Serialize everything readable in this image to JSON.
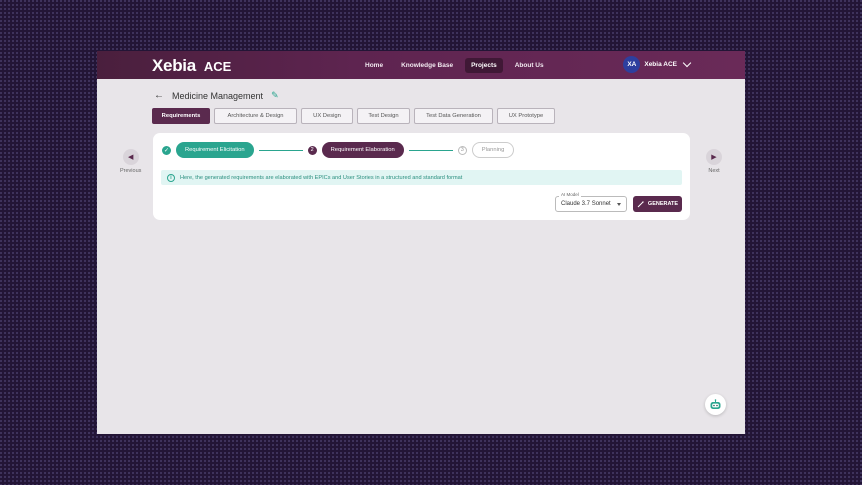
{
  "brand": {
    "logo_text": "Xebia",
    "product": "ACE"
  },
  "nav": [
    {
      "label": "Home",
      "active": false
    },
    {
      "label": "Knowledge Base",
      "active": false
    },
    {
      "label": "Projects",
      "active": true
    },
    {
      "label": "About Us",
      "active": false
    }
  ],
  "user": {
    "initials": "XA",
    "name": "Xebia ACE"
  },
  "page": {
    "back_icon": "arrow-left-icon",
    "title": "Medicine Management",
    "edit_icon": "pencil-icon"
  },
  "tabs": [
    {
      "label": "Requirements",
      "active": true
    },
    {
      "label": "Architecture & Design",
      "active": false
    },
    {
      "label": "UX Design",
      "active": false
    },
    {
      "label": "Test Design",
      "active": false
    },
    {
      "label": "Test Data Generation",
      "active": false
    },
    {
      "label": "UX Prototype",
      "active": false
    }
  ],
  "side_nav": {
    "previous": "Previous",
    "next": "Next"
  },
  "stepper": [
    {
      "marker": "✓",
      "label": "Requirement Elicitation",
      "state": "done"
    },
    {
      "marker": "2",
      "label": "Requirement Elaboration",
      "state": "current"
    },
    {
      "marker": "3",
      "label": "Planning",
      "state": "pending"
    }
  ],
  "info": {
    "icon": "info-icon",
    "text": "Here, the generated requirements are elaborated with EPICs and User Stories in a structured and standard format"
  },
  "model": {
    "label": "AI Model",
    "value": "Claude 3.7 Sonnet"
  },
  "generate": {
    "label": "GENERATE"
  },
  "colors": {
    "primary": "#5a2a4e",
    "accent": "#2aa58f",
    "header": "#5e2450"
  }
}
